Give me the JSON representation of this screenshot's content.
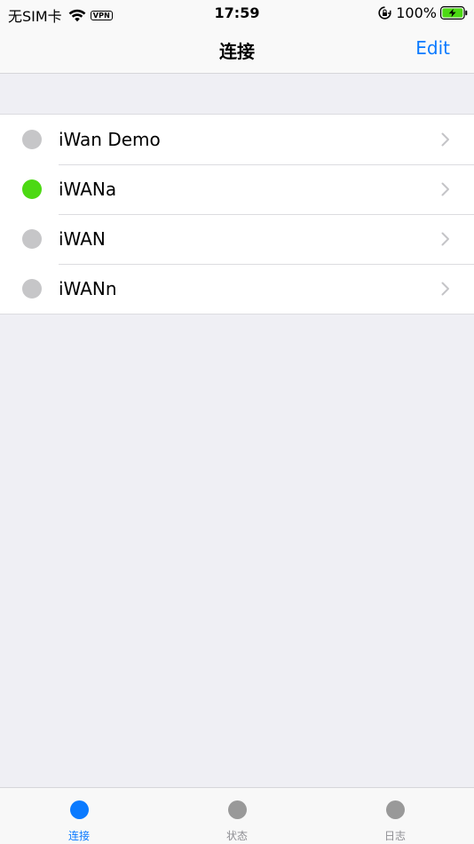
{
  "status_bar": {
    "carrier": "无SIM卡",
    "vpn": "VPN",
    "time": "17:59",
    "battery_percent": "100%"
  },
  "nav": {
    "title": "连接",
    "edit_label": "Edit"
  },
  "connections": [
    {
      "name": "iWan Demo",
      "status_color": "#c6c6c8"
    },
    {
      "name": "iWANa",
      "status_color": "#4cd913"
    },
    {
      "name": "iWAN",
      "status_color": "#c6c6c8"
    },
    {
      "name": "iWANn",
      "status_color": "#c6c6c8"
    }
  ],
  "tabs": [
    {
      "label": "连接",
      "active": true
    },
    {
      "label": "状态",
      "active": false
    },
    {
      "label": "日志",
      "active": false
    }
  ],
  "colors": {
    "accent": "#0a7aff",
    "connected": "#4cd913",
    "disconnected": "#c6c6c8"
  }
}
